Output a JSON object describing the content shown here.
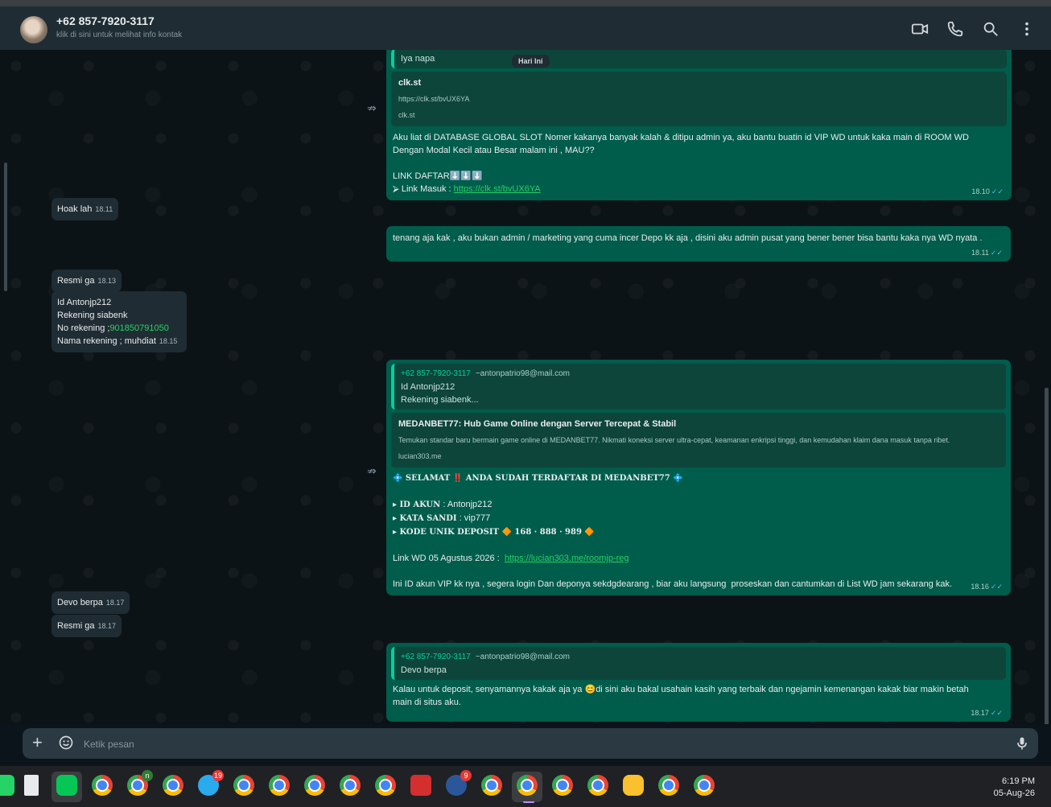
{
  "header": {
    "contact_name": "+62 857-7920-3117",
    "contact_subtitle": "klik di sini untuk melihat info kontak",
    "icons": [
      "video-call-icon",
      "voice-call-icon",
      "search-icon",
      "menu-icon"
    ]
  },
  "date_chip": "Hari Ini",
  "messages": {
    "m1": {
      "quote_text": "Iya napa",
      "link_title": "clk.st",
      "link_url": "https://clk.st/bvUX6YA",
      "link_domain": "clk.st",
      "text": "Aku liat di DATABASE GLOBAL SLOT Nomer kakanya banyak kalah & ditipu admin ya, aku bantu buatin id VIP WD untuk kaka main di ROOM WD\nDengan Modal Kecil atau Besar malam ini , MAU??",
      "text2": "LINK DAFTAR⬇️⬇️⬇️",
      "text3": "⮚ Link Masuk : ",
      "link": "https://clk.st/bvUX6YA",
      "time": "18.10"
    },
    "m2": {
      "text": "Hoak lah",
      "time": "18.11"
    },
    "m3": {
      "text": "tenang aja kak , aku bukan admin / marketing yang cuma incer Depo kk aja , disini aku admin pusat yang bener bener bisa bantu kaka nya WD nyata .",
      "time": "18.11"
    },
    "m4": {
      "text": "Resmi ga",
      "time": "18.13"
    },
    "m5": {
      "line1": "Id Antonjp212",
      "line2": "Rekening siabenk",
      "line3_prefix": "No rekening ;",
      "line3_number": "901850791050",
      "line4": "Nama rekening ; muhdiat",
      "time": "18.15"
    },
    "m6": {
      "quote_name": "+62 857-7920-3117",
      "quote_mail": "~antonpatrio98@mail.com",
      "quote_line1": "Id Antonjp212",
      "quote_line2": "Rekening siabenk...",
      "link_title": "MEDANBET77: Hub Game Online dengan Server Tercepat & Stabil",
      "link_desc": "Temukan standar baru bermain game online di MEDANBET77. Nikmati koneksi server ultra-cepat, keamanan enkripsi tinggi, dan kemudahan klaim dana masuk tanpa ribet.",
      "link_domain": "lucian303.me",
      "headline": "💠 SELAMAT ‼️ ANDA SUDAH TERDAFTAR DI MEDANBET77 💠",
      "id_label": "▸ ID AKUN",
      "id_value": " : Antonjp212",
      "pw_label": "▸ KATA SANDI",
      "pw_value": " : vip777",
      "code_label": "▸ KODE UNIK DEPOSIT",
      "code_value": " 🔶 168 · 888 · 989 🔶",
      "wd_prefix": "Link WD 05 Agustus 2026 :  ",
      "wd_link": "https://lucian303.me/roomjp-reg",
      "closing": "Ini ID akun VIP kk nya , segera login Dan deponya sekdgdearang , biar aku langsung  proseskan dan cantumkan di List WD jam sekarang kak.",
      "time": "18.16"
    },
    "m7": {
      "text": "Devo berpa",
      "time": "18.17"
    },
    "m8": {
      "text": "Resmi ga",
      "time": "18.17"
    },
    "m9": {
      "quote_name": "+62 857-7920-3117",
      "quote_mail": "~antonpatrio98@mail.com",
      "quote_line": "Devo berpa",
      "text_a": "Kalau untuk deposit, senyamannya kakak aja ya ",
      "emoji": "😊",
      "text_b": "di sini aku bakal usahain kasih yang terbaik dan ngejamin kemenangan kakak biar makin betah main di situs aku.",
      "time": "18.17"
    }
  },
  "composer": {
    "placeholder": "Ketik pesan"
  },
  "taskbar": {
    "badges": {
      "chrome3": "n",
      "telegram": "19",
      "app11": "9"
    },
    "time": "6:19 PM",
    "date": "05-Aug-26"
  },
  "colors": {
    "outgoing_bubble": "#005c4b",
    "incoming_bubble": "#202c33",
    "accent": "#06cf9c",
    "link": "#53bdeb"
  }
}
